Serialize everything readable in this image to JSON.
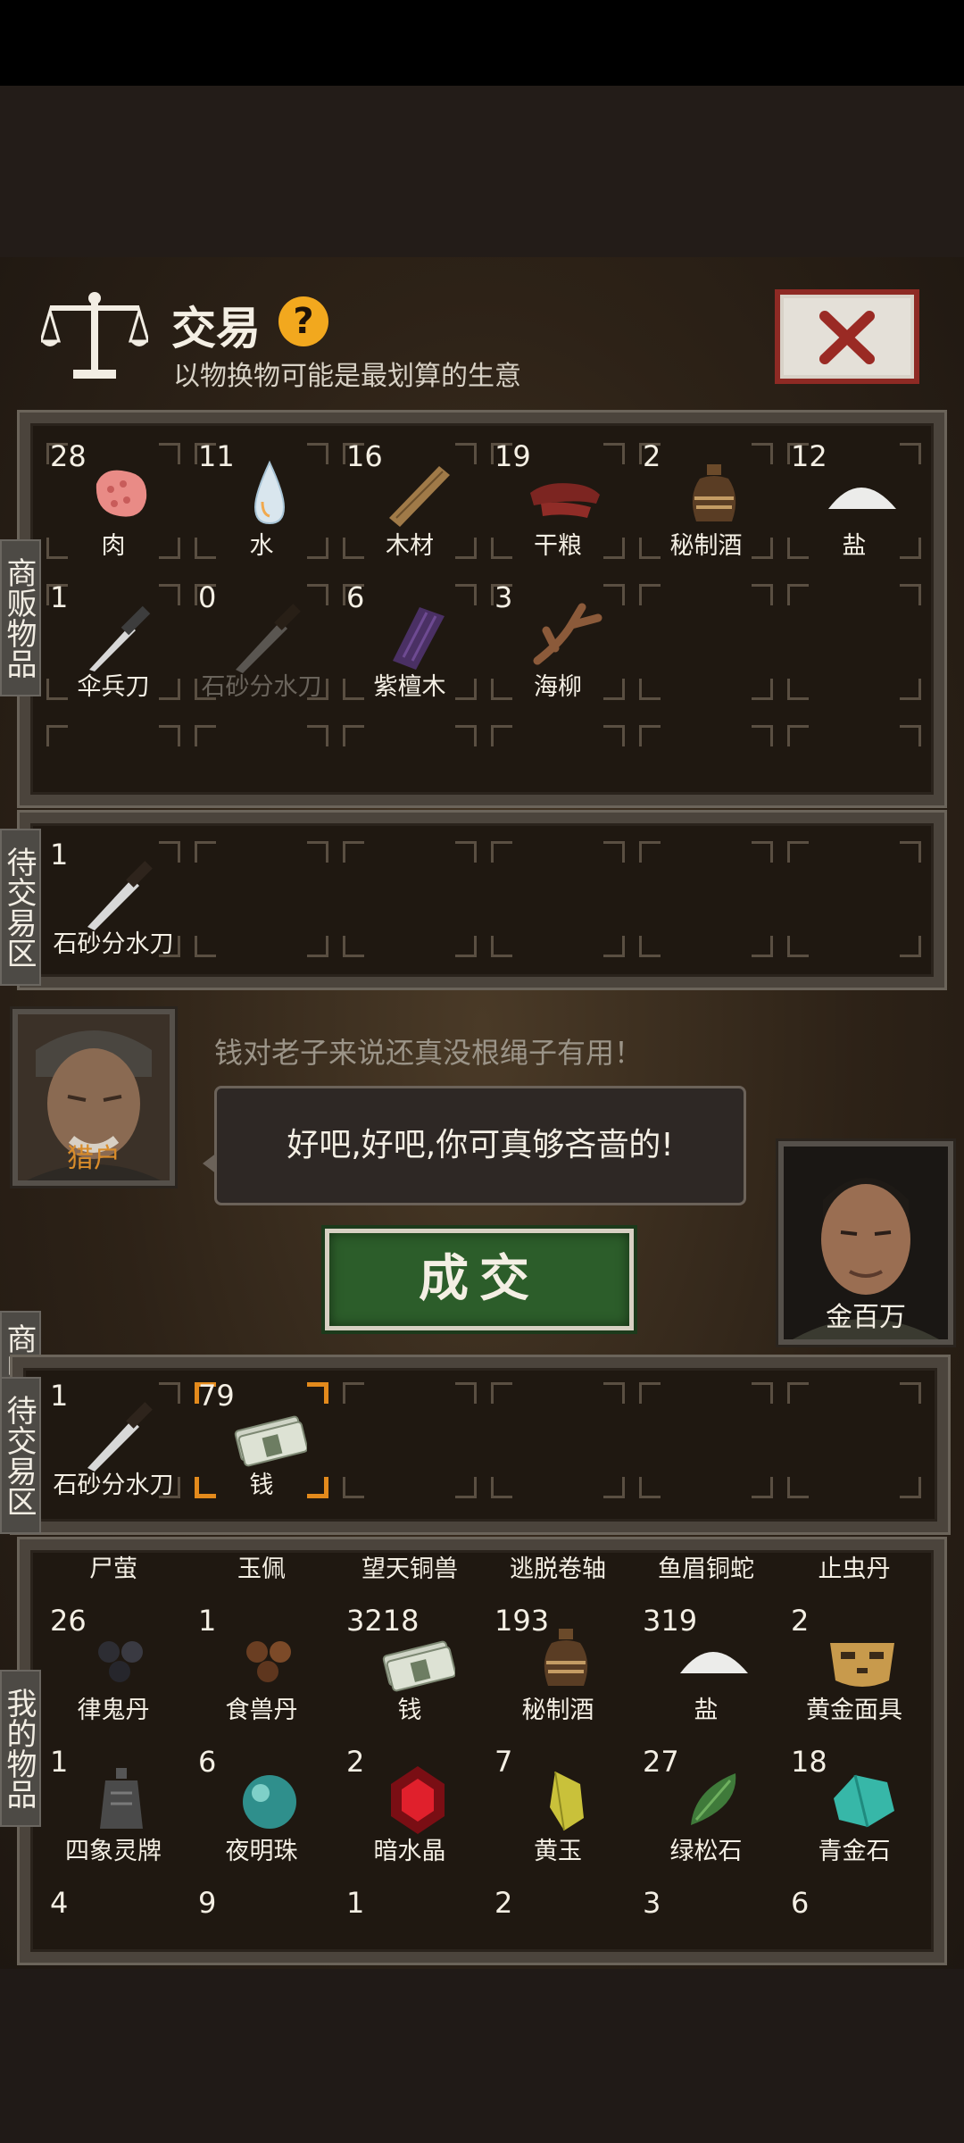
{
  "header": {
    "title": "交易",
    "help_label": "?",
    "subtitle": "以物换物可能是最划算的生意"
  },
  "side_labels": {
    "merchant_goods": "商贩物品",
    "pending_top": "待交易区",
    "merchant": "商贩",
    "pending_bottom": "待交易区",
    "my_goods": "我的物品"
  },
  "merchant_items": [
    {
      "count": "28",
      "name": "肉",
      "icon": "meat-icon"
    },
    {
      "count": "11",
      "name": "水",
      "icon": "water-icon"
    },
    {
      "count": "16",
      "name": "木材",
      "icon": "wood-icon"
    },
    {
      "count": "19",
      "name": "干粮",
      "icon": "jerky-icon"
    },
    {
      "count": "2",
      "name": "秘制酒",
      "icon": "wine-jar-icon"
    },
    {
      "count": "12",
      "name": "盐",
      "icon": "salt-icon"
    },
    {
      "count": "1",
      "name": "伞兵刀",
      "icon": "paratrooper-knife-icon"
    },
    {
      "count": "0",
      "name": "石砂分水刀",
      "icon": "knife-icon"
    },
    {
      "count": "6",
      "name": "紫檀木",
      "icon": "rosewood-icon"
    },
    {
      "count": "3",
      "name": "海柳",
      "icon": "sea-willow-icon"
    }
  ],
  "pending_merchant": [
    {
      "count": "1",
      "name": "石砂分水刀",
      "icon": "knife-icon"
    }
  ],
  "trader": {
    "npc_name": "猎户",
    "line1": "钱对老子来说还真没根绳子有用！",
    "bubble": "好吧,好吧,你可真够吝啬的!",
    "deal_button": "成交",
    "player_name": "金百万"
  },
  "pending_player": [
    {
      "count": "1",
      "name": "石砂分水刀",
      "icon": "knife-icon"
    },
    {
      "count": "79",
      "name": "钱",
      "icon": "money-icon"
    }
  ],
  "player_items_partial_top": [
    "尸萤",
    "玉佩",
    "望天铜兽",
    "逃脱卷轴",
    "鱼眉铜蛇",
    "止虫丹"
  ],
  "player_items": [
    {
      "count": "26",
      "name": "律鬼丹",
      "icon": "pills-dark-icon"
    },
    {
      "count": "1",
      "name": "食兽丹",
      "icon": "pills-brown-icon"
    },
    {
      "count": "3218",
      "name": "钱",
      "icon": "money-icon"
    },
    {
      "count": "193",
      "name": "秘制酒",
      "icon": "wine-jar-icon"
    },
    {
      "count": "319",
      "name": "盐",
      "icon": "salt-icon"
    },
    {
      "count": "2",
      "name": "黄金面具",
      "icon": "gold-mask-icon"
    },
    {
      "count": "1",
      "name": "四象灵牌",
      "icon": "bell-icon"
    },
    {
      "count": "6",
      "name": "夜明珠",
      "icon": "pearl-icon"
    },
    {
      "count": "2",
      "name": "暗水晶",
      "icon": "dark-crystal-icon"
    },
    {
      "count": "7",
      "name": "黄玉",
      "icon": "topaz-icon"
    },
    {
      "count": "27",
      "name": "绿松石",
      "icon": "turquoise-icon"
    },
    {
      "count": "18",
      "name": "青金石",
      "icon": "lapis-icon"
    }
  ],
  "player_items_partial_bottom_counts": [
    "4",
    "9",
    "1",
    "2",
    "3",
    "6"
  ],
  "colors": {
    "accent_orange": "#e38a1c",
    "deal_green": "#2c5d2a",
    "close_red": "#8e2a24",
    "help_yellow": "#f2a81e"
  }
}
